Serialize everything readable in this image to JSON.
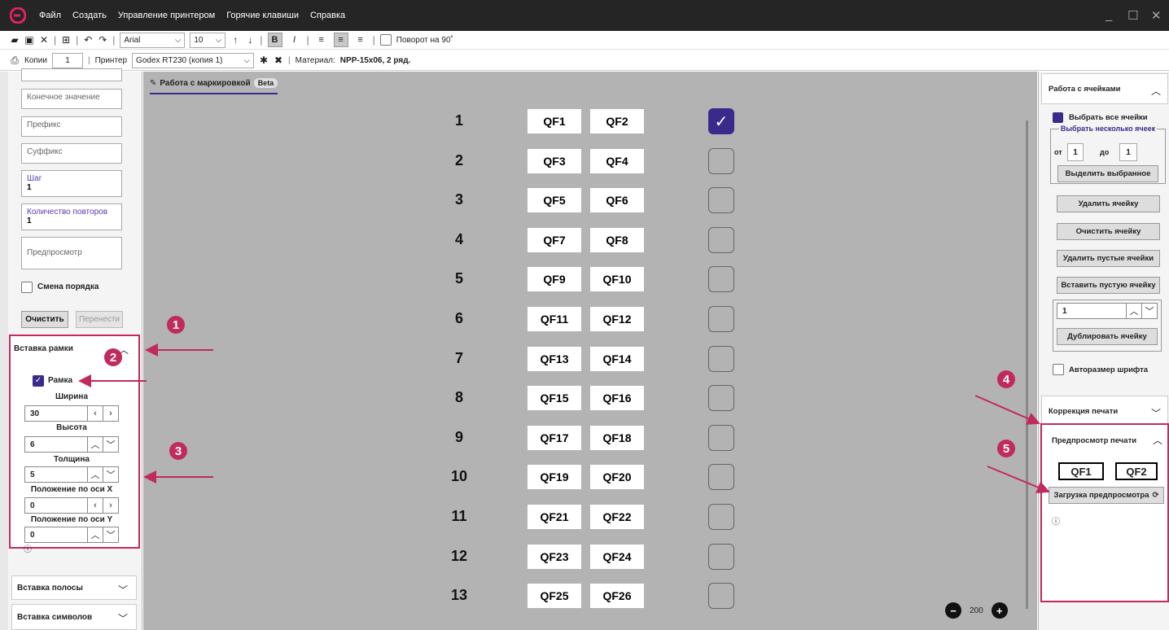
{
  "menu": [
    "Файл",
    "Создать",
    "Управление принтером",
    "Горячие клавиши",
    "Справка"
  ],
  "toolbar": {
    "font": "Arial",
    "size": "10",
    "rotate_label": "Поворот на 90˚"
  },
  "print_bar": {
    "copies_label": "Копии",
    "copies_value": "1",
    "printer_label": "Принтер",
    "printer_value": "Godex RT230 (копия 1)",
    "material_label": "Материал:",
    "material_value": "NPP-15x06, 2 ряд."
  },
  "left": {
    "end_value": "Конечное значение",
    "prefix": "Префикс",
    "suffix": "Суффикс",
    "step_label": "Шаг",
    "step_value": "1",
    "repeat_label": "Количество повторов",
    "repeat_value": "1",
    "preview": "Предпросмотр",
    "reorder": "Смена порядка",
    "clear": "Очистить",
    "move": "Перенести",
    "frame_section": "Вставка рамки",
    "frame_check": "Рамка",
    "width_label": "Ширина",
    "width_value": "30",
    "height_label": "Высота",
    "height_value": "6",
    "thickness_label": "Толщина",
    "thickness_value": "5",
    "posx_label": "Положение по оси X",
    "posx_value": "0",
    "posy_label": "Положение по оси Y",
    "posy_value": "0",
    "stripe_section": "Вставка полосы",
    "symbols_section": "Вставка символов"
  },
  "canvas": {
    "tab_label": "Работа с маркировкой",
    "beta": "Beta",
    "zoom": "200",
    "rows": [
      {
        "n": "1",
        "a": "QF1",
        "b": "QF2",
        "checked": true
      },
      {
        "n": "2",
        "a": "QF3",
        "b": "QF4",
        "checked": false
      },
      {
        "n": "3",
        "a": "QF5",
        "b": "QF6",
        "checked": false
      },
      {
        "n": "4",
        "a": "QF7",
        "b": "QF8",
        "checked": false
      },
      {
        "n": "5",
        "a": "QF9",
        "b": "QF10",
        "checked": false
      },
      {
        "n": "6",
        "a": "QF11",
        "b": "QF12",
        "checked": false
      },
      {
        "n": "7",
        "a": "QF13",
        "b": "QF14",
        "checked": false
      },
      {
        "n": "8",
        "a": "QF15",
        "b": "QF16",
        "checked": false
      },
      {
        "n": "9",
        "a": "QF17",
        "b": "QF18",
        "checked": false
      },
      {
        "n": "10",
        "a": "QF19",
        "b": "QF20",
        "checked": false
      },
      {
        "n": "11",
        "a": "QF21",
        "b": "QF22",
        "checked": false
      },
      {
        "n": "12",
        "a": "QF23",
        "b": "QF24",
        "checked": false
      },
      {
        "n": "13",
        "a": "QF25",
        "b": "QF26",
        "checked": false
      }
    ]
  },
  "right": {
    "cells_section": "Работа с ячейками",
    "select_all": "Выбрать все ячейки",
    "select_several": "Выбрать несколько ячеек",
    "from_label": "от",
    "from_value": "1",
    "to_label": "до",
    "to_value": "1",
    "select_btn": "Выделить выбранное",
    "delete_cell": "Удалить ячейку",
    "clear_cell": "Очистить ячейку",
    "delete_empty": "Удалить пустые ячейки",
    "insert_empty": "Вставить пустую ячейку",
    "dup_value": "1",
    "duplicate": "Дублировать ячейку",
    "autosize": "Авторазмер шрифта",
    "correction_section": "Коррекция печати",
    "preview_section": "Предпросмотр печати",
    "preview_a": "QF1",
    "preview_b": "QF2",
    "load_preview": "Загрузка предпросмотра"
  },
  "callouts": [
    "1",
    "2",
    "3",
    "4",
    "5"
  ],
  "colors": {
    "accent": "#3a2a8c",
    "callout": "#c12a5d",
    "titlebar": "#252525",
    "canvas": "#b3b3b3"
  }
}
